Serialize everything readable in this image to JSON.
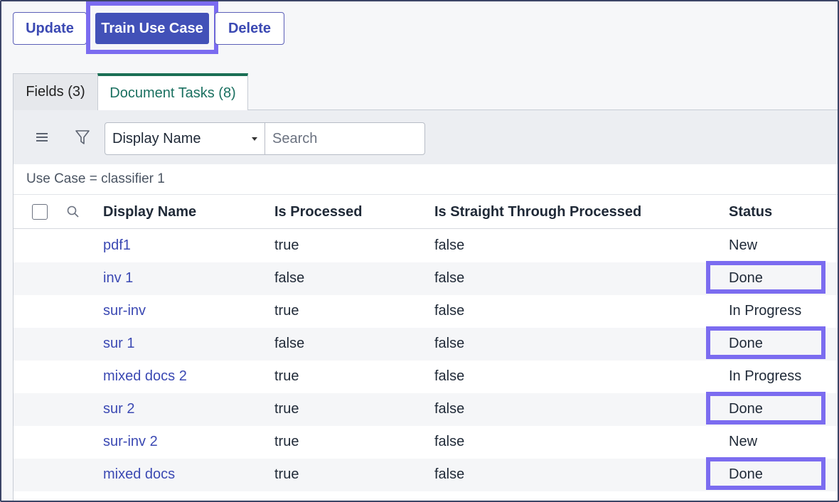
{
  "toolbar": {
    "update_label": "Update",
    "train_label": "Train Use Case",
    "delete_label": "Delete"
  },
  "tabs": [
    {
      "label": "Fields (3)",
      "active": false
    },
    {
      "label": "Document Tasks (8)",
      "active": true
    }
  ],
  "filter": {
    "select_value": "Display Name",
    "search_placeholder": "Search",
    "breadcrumb": "Use Case = classifier 1"
  },
  "table": {
    "columns": [
      "Display Name",
      "Is Processed",
      "Is Straight Through Processed",
      "Status"
    ],
    "rows": [
      {
        "name": "pdf1",
        "processed": "true",
        "stp": "false",
        "status": "New",
        "highlight": false
      },
      {
        "name": "inv 1",
        "processed": "false",
        "stp": "false",
        "status": "Done",
        "highlight": true
      },
      {
        "name": "sur-inv",
        "processed": "true",
        "stp": "false",
        "status": "In Progress",
        "highlight": false
      },
      {
        "name": "sur 1",
        "processed": "false",
        "stp": "false",
        "status": "Done",
        "highlight": true
      },
      {
        "name": "mixed docs 2",
        "processed": "true",
        "stp": "false",
        "status": "In Progress",
        "highlight": false
      },
      {
        "name": "sur 2",
        "processed": "true",
        "stp": "false",
        "status": "Done",
        "highlight": true
      },
      {
        "name": "sur-inv 2",
        "processed": "true",
        "stp": "false",
        "status": "New",
        "highlight": false
      },
      {
        "name": "mixed docs",
        "processed": "true",
        "stp": "false",
        "status": "Done",
        "highlight": true
      }
    ]
  },
  "colors": {
    "accent": "#4251b8",
    "highlight": "#7b6cf0",
    "active_tab": "#1a6f55",
    "link": "#3b49b3"
  },
  "icons": [
    "menu-icon",
    "filter-icon",
    "search-icon"
  ]
}
